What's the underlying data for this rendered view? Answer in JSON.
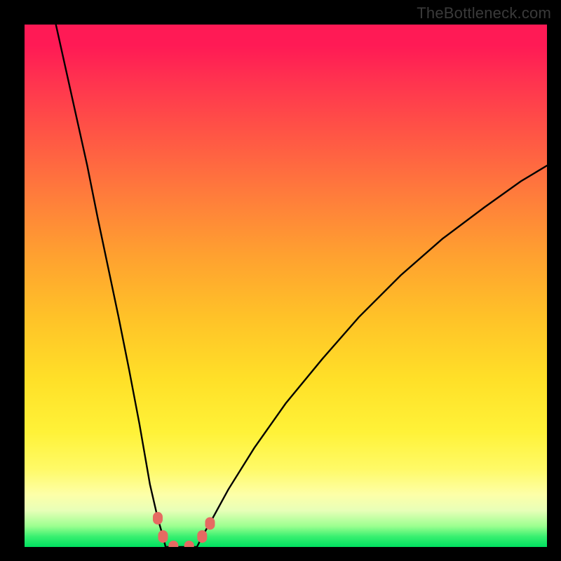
{
  "watermark": {
    "text": "TheBottleneck.com"
  },
  "chart_data": {
    "type": "line",
    "title": "",
    "subtitle": "",
    "xlabel": "",
    "ylabel": "",
    "xlim": [
      0,
      100
    ],
    "ylim": [
      0,
      100
    ],
    "grid": false,
    "legend": false,
    "series": [
      {
        "name": "left-branch",
        "x": [
          6,
          8,
          10,
          12,
          14,
          16,
          18,
          20,
          22,
          24,
          25.5,
          26.5,
          27
        ],
        "y": [
          100,
          91,
          82,
          73,
          63,
          53.5,
          44,
          34,
          23.5,
          12,
          5.5,
          2,
          0
        ]
      },
      {
        "name": "bottom-flat",
        "x": [
          27,
          30,
          32,
          33
        ],
        "y": [
          0,
          0,
          0,
          0
        ]
      },
      {
        "name": "right-branch",
        "x": [
          33,
          34,
          36,
          39,
          44,
          50,
          57,
          64,
          72,
          80,
          88,
          95,
          100
        ],
        "y": [
          0,
          2,
          5.5,
          11,
          19,
          27.5,
          36,
          44,
          52,
          59,
          65,
          70,
          73
        ]
      }
    ],
    "markers": [
      {
        "name": "marker-left-upper",
        "x": 25.5,
        "y": 5.5
      },
      {
        "name": "marker-left-lower",
        "x": 26.5,
        "y": 2.0
      },
      {
        "name": "marker-bottom-left",
        "x": 28.5,
        "y": 0.0
      },
      {
        "name": "marker-bottom-right",
        "x": 31.5,
        "y": 0.0
      },
      {
        "name": "marker-right-lower",
        "x": 34.0,
        "y": 2.0
      },
      {
        "name": "marker-right-upper",
        "x": 35.5,
        "y": 4.5
      }
    ],
    "colors": {
      "curve": "#000000",
      "marker": "#e66a62",
      "gradient_top": "#ff1a55",
      "gradient_mid": "#ffc530",
      "gradient_low": "#fffa66",
      "gradient_bottom": "#00e060",
      "frame": "#000000"
    }
  }
}
